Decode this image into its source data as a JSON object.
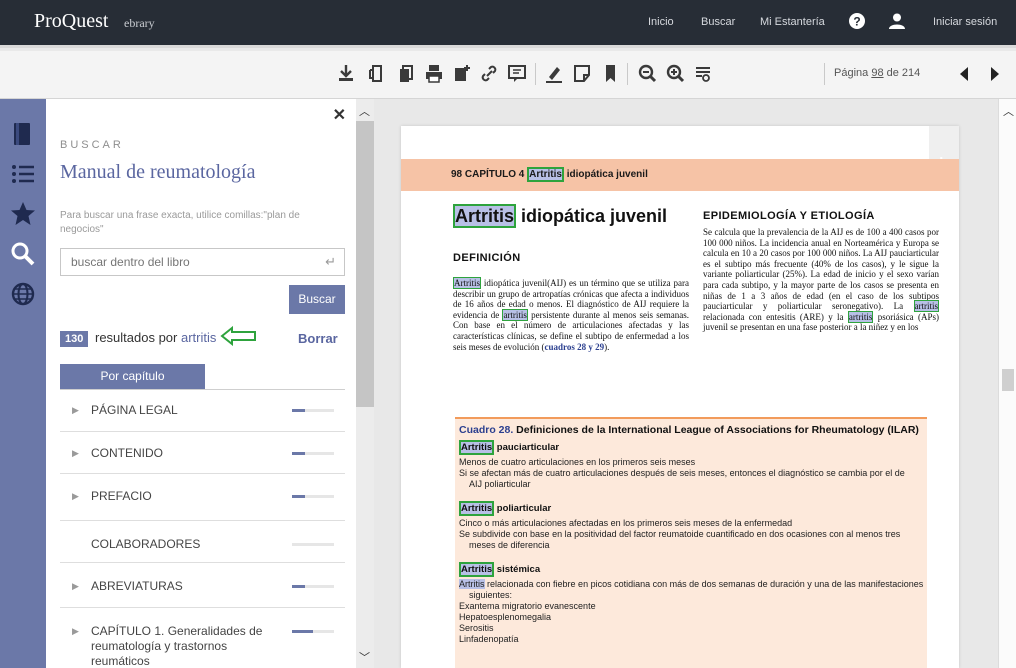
{
  "topbar": {
    "brand": "ProQuest",
    "sub_brand": "ebrary",
    "nav": [
      "Inicio",
      "Buscar",
      "Mi Estantería"
    ],
    "help_icon": "help-icon",
    "user_icon": "user-icon",
    "signin": "Iniciar sesión"
  },
  "toolbar": {
    "icons": [
      "download-icon",
      "copy-page-icon",
      "duplicate-icon",
      "print-icon",
      "bookmark-add-icon",
      "link-icon",
      "comment-icon",
      "highlight-icon",
      "note-icon",
      "bookmark-icon",
      "zoom-out-icon",
      "zoom-in-icon",
      "fit-page-icon"
    ],
    "page_prefix": "Página",
    "page_current": "98",
    "page_of": "de 214"
  },
  "rail": {
    "icons": [
      "book-icon",
      "list-icon",
      "star-icon",
      "search-icon",
      "globe-icon"
    ]
  },
  "search_panel": {
    "kicker": "BUSCAR",
    "book_title": "Manual de reumatología",
    "hint": "Para buscar una frase exacta, utilice comillas:\"plan de negocios\"",
    "search_placeholder": "buscar dentro del libro",
    "search_button": "Buscar",
    "result_count": "130",
    "results_label": "resultados por",
    "search_term": "artritis",
    "clear_label": "Borrar",
    "tab_label": "Por capítulo",
    "chapters": [
      {
        "label": "PÁGINA LEGAL",
        "fill": 0.3
      },
      {
        "label": "CONTENIDO",
        "fill": 0.3
      },
      {
        "label": "PREFACIO",
        "fill": 0.3
      },
      {
        "label": "COLABORADORES",
        "fill": 0
      },
      {
        "label": "ABREVIATURAS",
        "fill": 0.3
      },
      {
        "label": "CAPÍTULO 1. Generalidades de reumatología y trastornos reumáticos",
        "fill": 0.5
      }
    ]
  },
  "document": {
    "running_head_prefix": "98   CAPÍTULO 4",
    "running_head_hl": "Artritis",
    "running_head_rest": "idiopática juvenil",
    "title_hl": "Artritis",
    "title_rest": " idiopática juvenil",
    "section_def": "DEFINICIÓN",
    "section_epi": "EPIDEMIOLOGÍA Y ETIOLOGÍA",
    "def_hl": "Artritis",
    "def_text": " idiopática juvenil(AIJ) es un término que se utiliza para describir un grupo de artropatías crónicas que afecta a individuos de 16 años de edad o menos. El diagnóstico de AIJ requiere la evidencia de ",
    "def_hl2": "artritis",
    "def_text2": " persistente durante al menos seis semanas. Con base en el número de articulaciones afectadas y las características clínicas, se define el subtipo de enfermedad a los seis meses de evolución (",
    "def_xref": "cuadros 28 y 29",
    "def_end": ").",
    "epi_text": "Se calcula que la prevalencia de la AIJ es de 100 a 400 casos por 100 000 niños. La incidencia anual en Norteamérica y Europa se calcula en 10 a 20 casos por 100 000 niños. La AIJ pauciarticular es el subtipo más frecuente (40% de los casos), y le sigue la variante poliarticular (25%). La edad de inicio y el sexo varían para cada subtipo, y la mayor parte de los casos se presenta en niñas de 1 a 3 años de edad (en el caso de los subtipos pauciarticular y poliarticular seronegativo). La ",
    "epi_hl": "artritis",
    "epi_text2": " relacionada con entesitis (ARE) y la ",
    "epi_hl2": "artritis",
    "epi_text3": " psoriásica (APs) juvenil se presentan en una fase posterior a la niñez y en los",
    "table_num": "Cuadro 28.",
    "table_title": " Definiciones de la International League of Associations for Rheumatology (ILAR)",
    "sub1_hl": "Artritis",
    "sub1_rest": " pauciarticular",
    "sub1_l1": "Menos de cuatro articulaciones en los primeros seis meses",
    "sub1_l2": "Si se afectan más de cuatro articulaciones después de seis meses, entonces el diagnóstico se cambia por el de",
    "sub1_l3": "AIJ poliarticular",
    "sub2_hl": "Artritis",
    "sub2_rest": " poliarticular",
    "sub2_l1": "Cinco o más articulaciones afectadas en los primeros seis meses de la enfermedad",
    "sub2_l2": "Se subdivide con base en la positividad del factor reumatoide cuantificado en dos ocasiones con al menos tres",
    "sub2_l3": "meses de diferencia",
    "sub3_hl": "Artritis",
    "sub3_rest": " sistémica",
    "sub3_l1_hl": "Artritis",
    "sub3_l1": " relacionada con fiebre en picos cotidiana con más de dos semanas de duración y una de las manifestaciones",
    "sub3_l2": "siguientes:",
    "sub3_l3": "Exantema migratorio evanescente",
    "sub3_l4": "Hepatoesplenomegalia",
    "sub3_l5": "Serositis",
    "sub3_l6": "Linfadenopatía"
  },
  "colors": {
    "accent": "#6b78a8",
    "topbar": "#272d36",
    "running_head": "#f6c3a6",
    "table_bg": "#fde9db",
    "match_box": "#2ea33d"
  }
}
